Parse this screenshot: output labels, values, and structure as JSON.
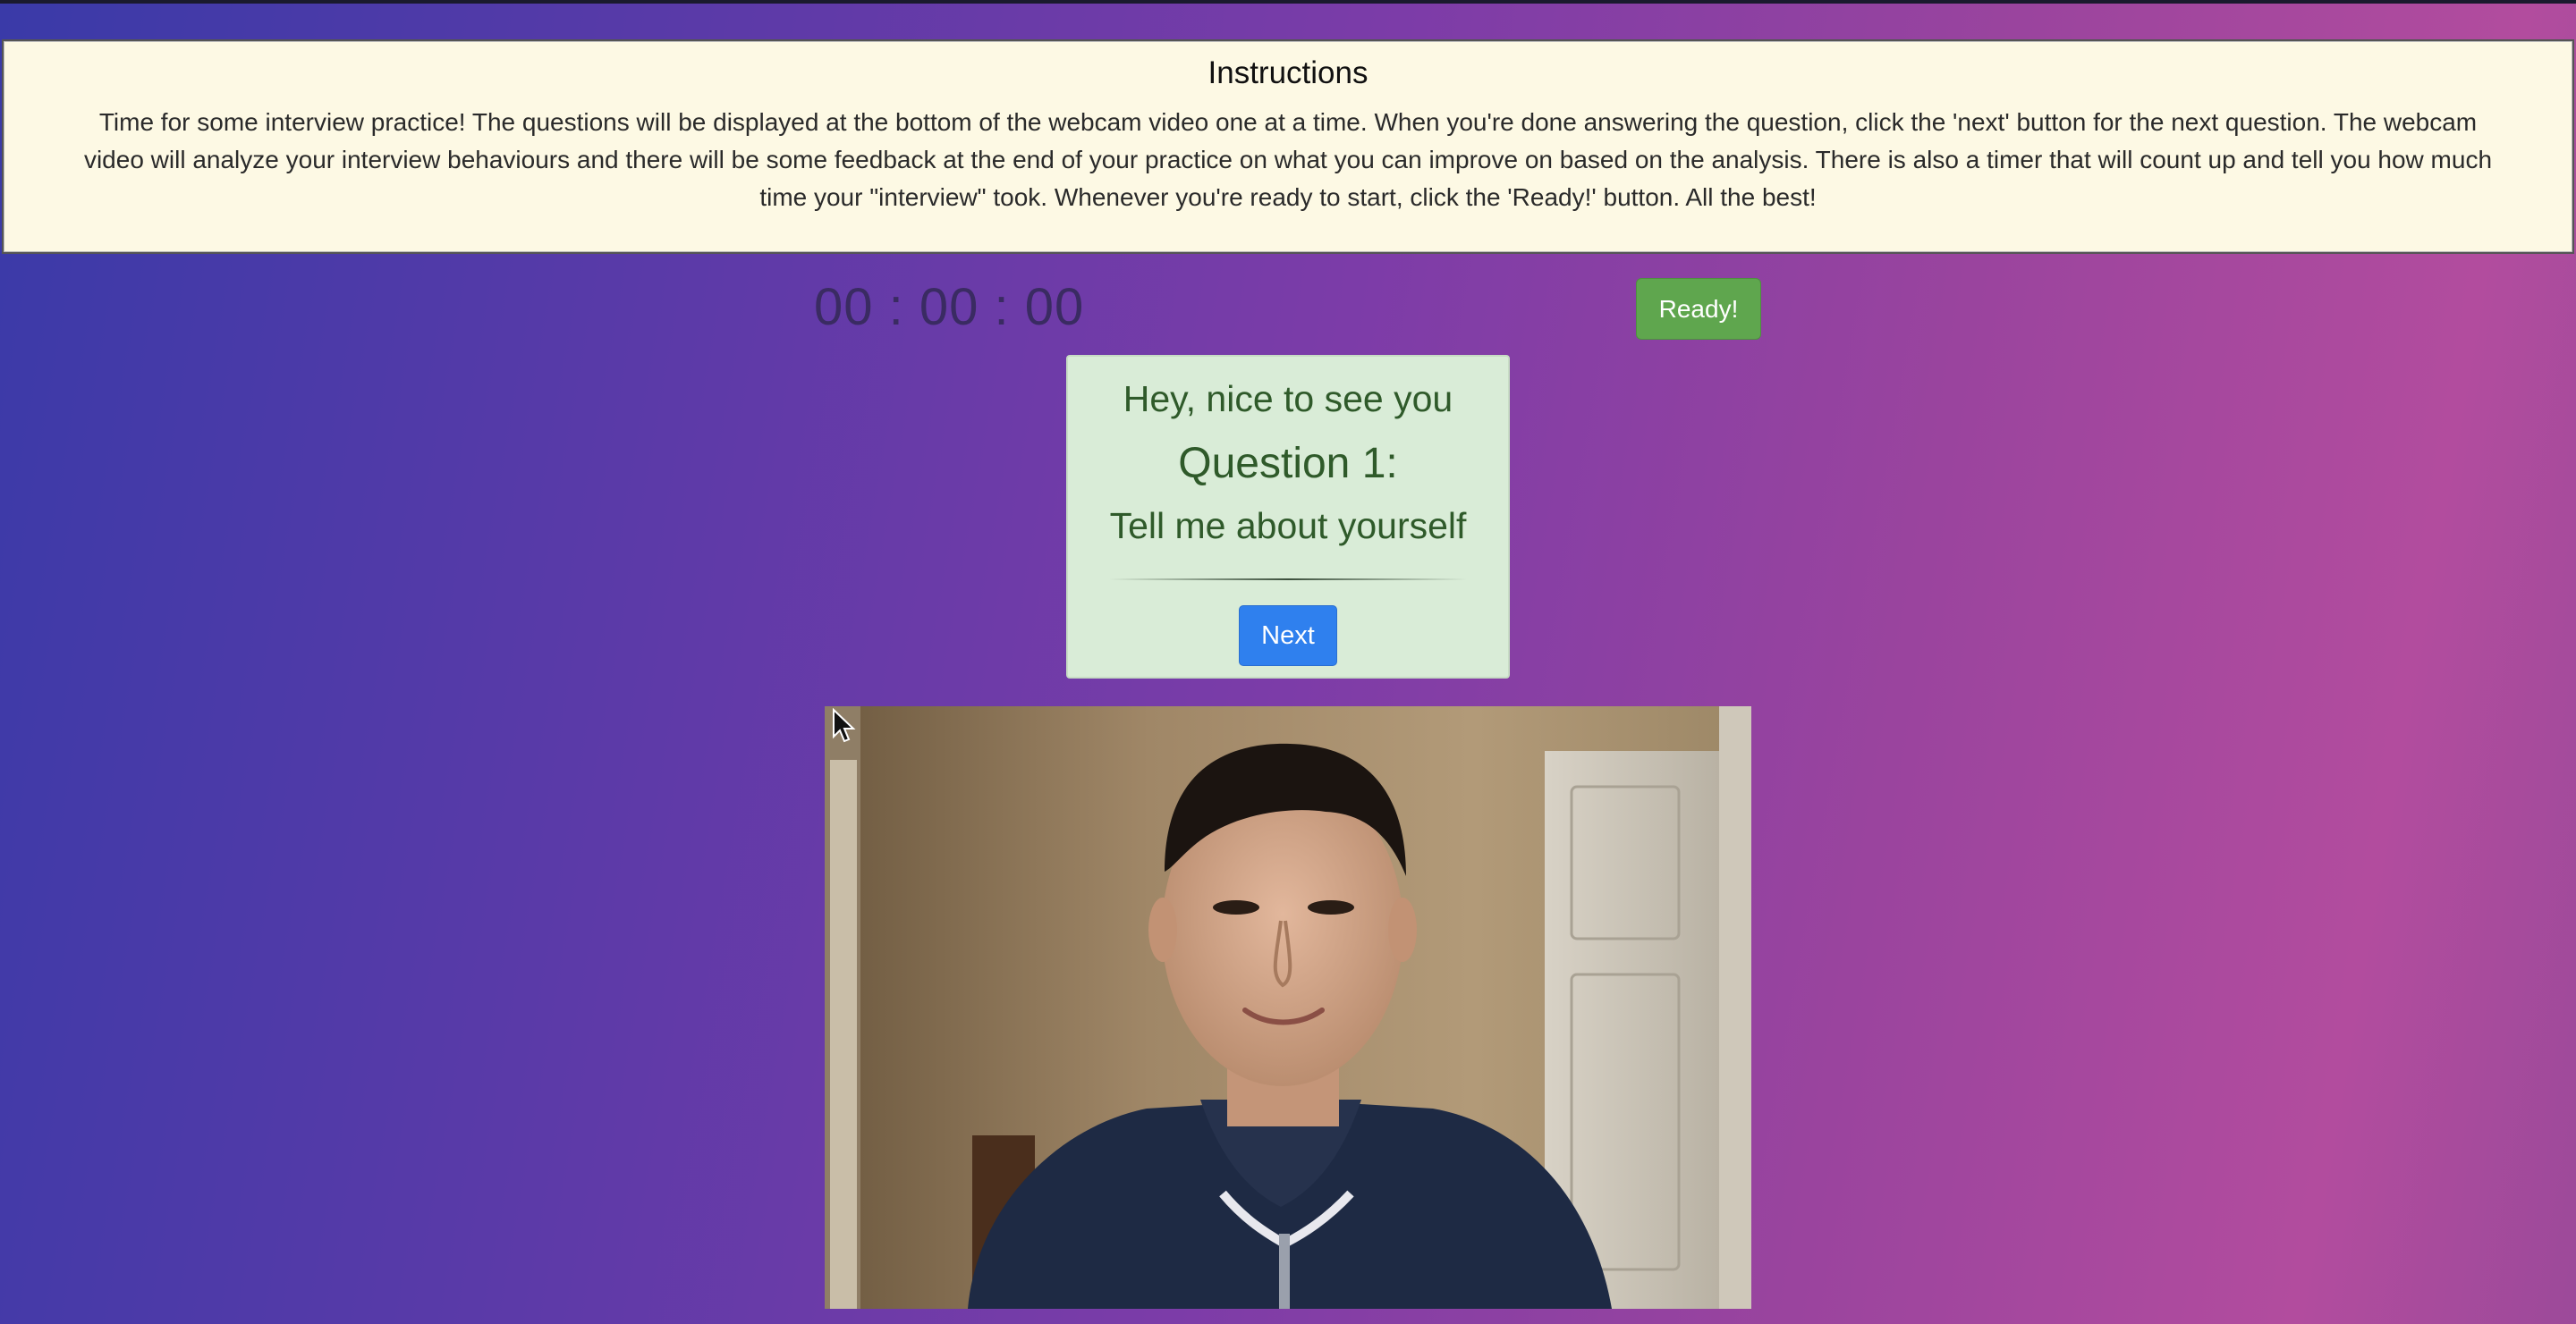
{
  "instructions": {
    "title": "Instructions",
    "body": "Time for some interview practice! The questions will be displayed at the bottom of the webcam video one at a time. When you're done answering the question, click the 'next' button for the next question. The webcam video will analyze your interview behaviours and there will be some feedback at the end of your practice on what you can improve on based on the analysis. There is also a timer that will count up and tell you how much time your \"interview\" took. Whenever you're ready to start, click the 'Ready!' button. All the best!"
  },
  "timer": {
    "display": "00 : 00 : 00"
  },
  "ready_button": {
    "label": "Ready!"
  },
  "question_card": {
    "greeting": "Hey, nice to see you",
    "question_number": "Question 1:",
    "question_text": "Tell me about yourself",
    "next_label": "Next"
  },
  "colors": {
    "ready_button": "#5fa64e",
    "next_button": "#2f80ee",
    "card_background": "#d9ecd7",
    "instructions_background": "#fdf9e4"
  }
}
